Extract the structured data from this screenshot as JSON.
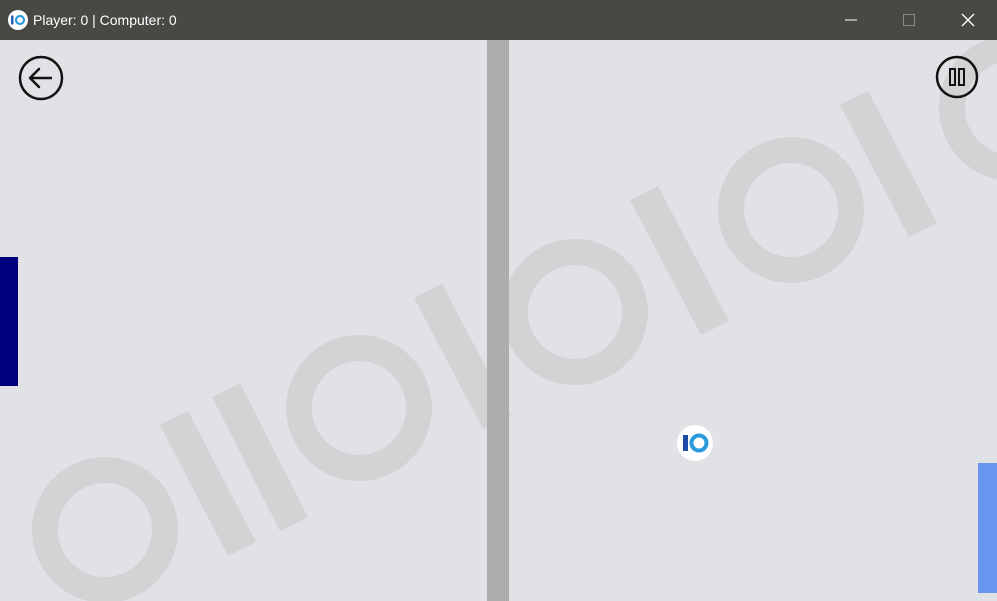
{
  "window": {
    "title": "Player: 0 | Computer: 0",
    "app_icon": "io-logo-icon",
    "controls": [
      "minimize-icon",
      "maximize-icon",
      "close-icon"
    ]
  },
  "game": {
    "player_score": 0,
    "computer_score": 0,
    "colors": {
      "background": "#e1e2e5",
      "net": "#adadad",
      "player_paddle": "#00007f",
      "computer_paddle": "#6797ee",
      "watermark": "#d3d3d5",
      "titlebar": "#4a4845"
    },
    "buttons": {
      "back_icon": "arrow-left-circle-icon",
      "pause_icon": "pause-circle-icon"
    },
    "ball_icon": "io-logo-icon",
    "watermark_text": "OIIOIOIOIO"
  }
}
